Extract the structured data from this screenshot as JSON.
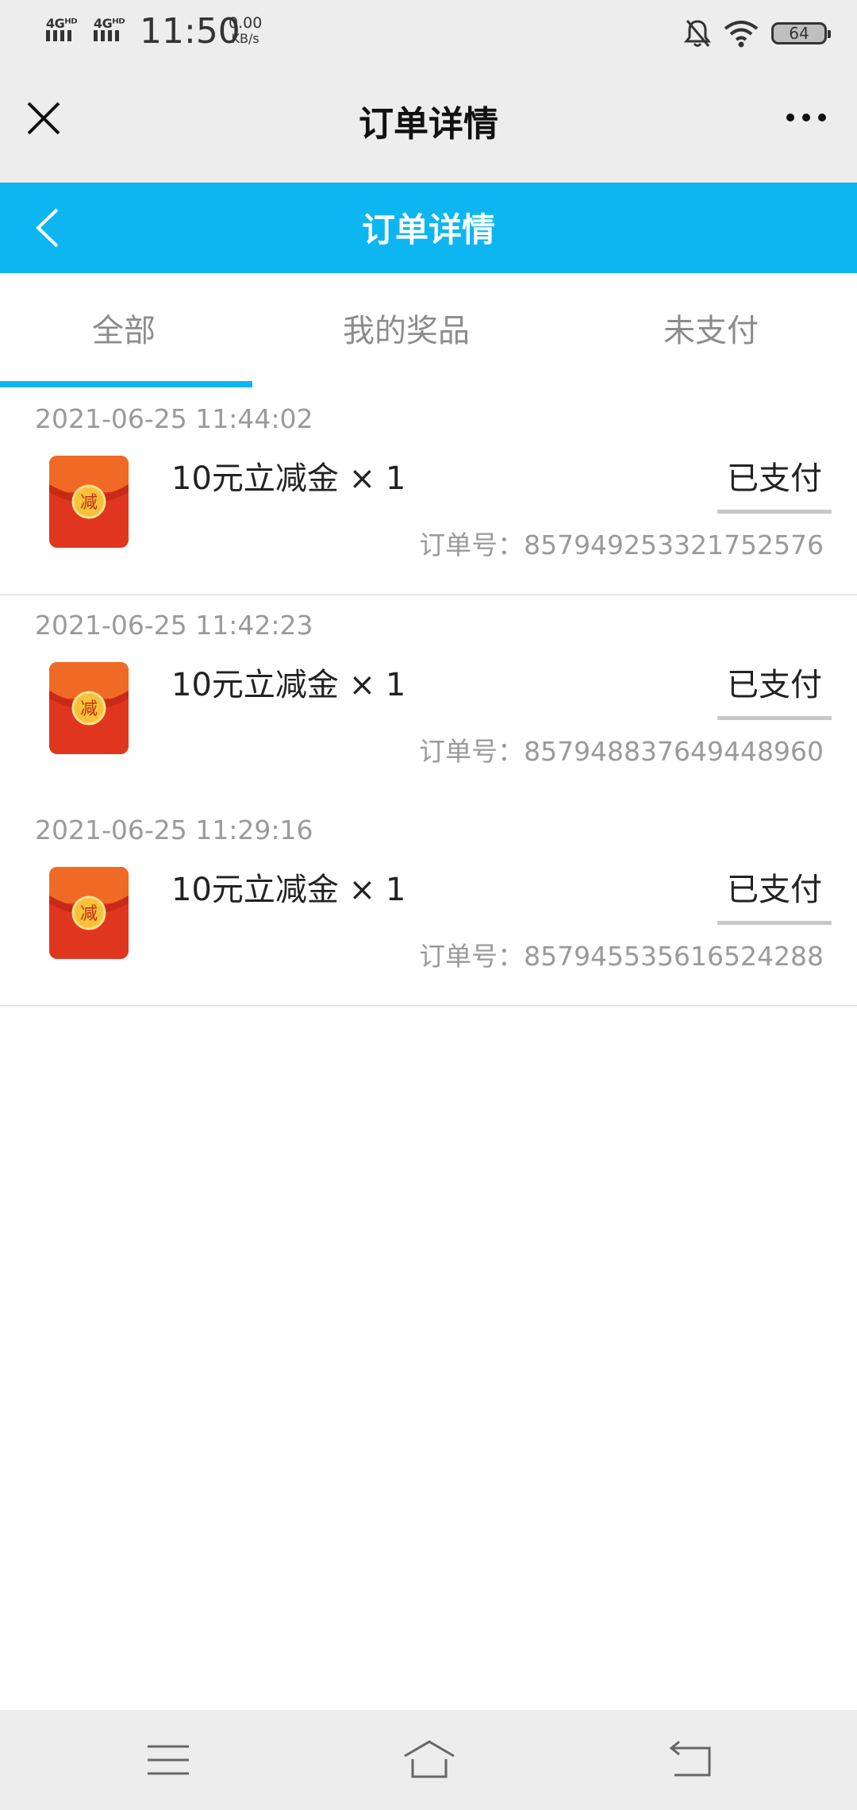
{
  "status_bar": {
    "network1": "4Gᴴᴰ",
    "network2": "4Gᴴᴰ",
    "time": "11:50",
    "speed_value": "0.00",
    "speed_unit": "KB/s",
    "battery": "64"
  },
  "title_bar": {
    "title": "订单详情"
  },
  "header": {
    "title": "订单详情"
  },
  "tabs": [
    {
      "label": "全部",
      "active": true
    },
    {
      "label": "我的奖品",
      "active": false
    },
    {
      "label": "未支付",
      "active": false
    }
  ],
  "orders": [
    {
      "date": "2021-06-25 11:44:02",
      "name": "10元立减金 × 1",
      "status": "已支付",
      "order_no": "订单号：857949253321752576"
    },
    {
      "date": "2021-06-25 11:42:23",
      "name": "10元立减金 × 1",
      "status": "已支付",
      "order_no": "订单号：857948837649448960"
    },
    {
      "date": "2021-06-25 11:29:16",
      "name": "10元立减金 × 1",
      "status": "已支付",
      "order_no": "订单号：857945535616524288"
    }
  ],
  "icons": {
    "close": "close-icon",
    "more": "more-icon",
    "back": "back-icon",
    "menu": "menu-icon",
    "home": "home-icon",
    "return": "return-icon"
  },
  "colors": {
    "accent": "#0db6f0",
    "status_bar_bg": "#ededed"
  }
}
